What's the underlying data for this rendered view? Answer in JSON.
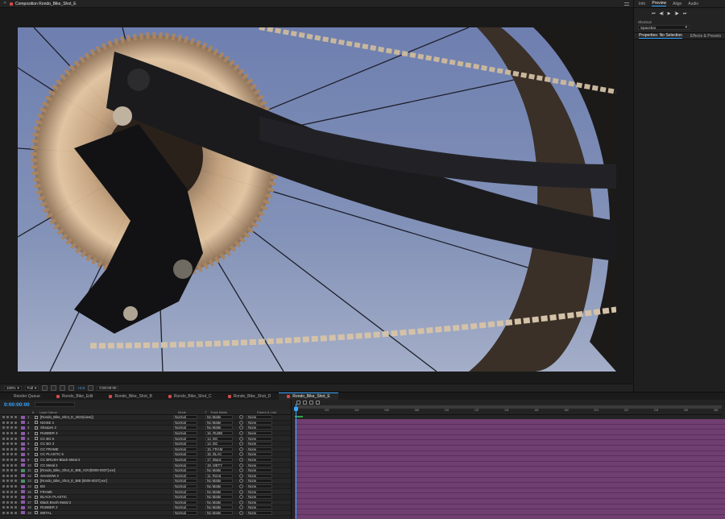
{
  "composition": {
    "tab_title": "Composition  Rondo_Bike_Shot_E"
  },
  "viewer_controls": {
    "zoom": "100%",
    "resolution": "Full",
    "exposure": "+0.0",
    "timecode": "0:00:00:00"
  },
  "right_panel": {
    "tabs": [
      "Info",
      "Preview",
      "Align",
      "Audio"
    ],
    "active_tab": "Preview",
    "transport": [
      "⏮",
      "◀|",
      "▶",
      "|▶",
      "⏭"
    ],
    "shortcut_label": "Shortcut",
    "shortcut_value": "Spacebar",
    "properties_tab": "Properties: No Selection",
    "effects_tab": "Effects & Presets"
  },
  "timeline_tabs": [
    {
      "label": "Render Queue",
      "color": "#1d1d1d"
    },
    {
      "label": "Rondo_Bike_Edit",
      "color": "#d14b4b"
    },
    {
      "label": "Rondo_Bike_Shot_B",
      "color": "#d14b4b"
    },
    {
      "label": "Rondo_Bike_Shot_C",
      "color": "#d14b4b"
    },
    {
      "label": "Rondo_Bike_Shot_D",
      "color": "#d14b4b"
    },
    {
      "label": "Rondo_Bike_Shot_E",
      "color": "#d14b4b"
    }
  ],
  "timeline": {
    "timecode": "0:00:00:00",
    "columns": {
      "num": "#",
      "layer_name": "Layer Name",
      "mode": "Mode",
      "t": "T",
      "track_matte": "Track Matte",
      "parent": "Parent & Link"
    },
    "ruler_ticks": [
      "0f",
      "02f",
      "04f",
      "06f",
      "08f",
      "10f",
      "12f",
      "14f",
      "16f",
      "18f",
      "20f",
      "22f",
      "24f",
      "26f",
      "28f"
    ],
    "layers": [
      {
        "num": "1",
        "name": "[Rondo_Bike_Shot_E_2022(view)]",
        "mode": "Normal",
        "matte": "No Matte",
        "parent": "None",
        "label": "#8a5aa8"
      },
      {
        "num": "2",
        "name": "NOISE 2",
        "mode": "Normal",
        "matte": "No Matte",
        "parent": "None",
        "label": "#8a5aa8"
      },
      {
        "num": "3",
        "name": "Sharpen 2",
        "mode": "Normal",
        "matte": "No Matte",
        "parent": "None",
        "label": "#8a5aa8"
      },
      {
        "num": "4",
        "name": "RUBBER 3",
        "mode": "Normal",
        "matte": "16. RUBB",
        "parent": "None",
        "label": "#8a5aa8"
      },
      {
        "num": "5",
        "name": "CC BG 6",
        "mode": "Normal",
        "matte": "14. BG",
        "parent": "None",
        "label": "#8a5aa8"
      },
      {
        "num": "6",
        "name": "CC BG 3",
        "mode": "Normal",
        "matte": "14. BG",
        "parent": "None",
        "label": "#8a5aa8"
      },
      {
        "num": "7",
        "name": "CC FRAME",
        "mode": "Normal",
        "matte": "15. FRAM",
        "parent": "None",
        "label": "#8a5aa8"
      },
      {
        "num": "8",
        "name": "CC PLASTIC 5",
        "mode": "Normal",
        "matte": "16. BLAC",
        "parent": "None",
        "label": "#8a5aa8"
      },
      {
        "num": "9",
        "name": "CC BRUSH Black Metal 2",
        "mode": "Normal",
        "matte": "17. Black",
        "parent": "None",
        "label": "#8a5aa8"
      },
      {
        "num": "10",
        "name": "CC Metal 2",
        "mode": "Normal",
        "matte": "19. METY",
        "parent": "None",
        "label": "#8a5aa8"
      },
      {
        "num": "11",
        "name": "[Rondo_Bike_Shot_E_BIB_AOV[0000-0037].exr]",
        "mode": "Normal",
        "matte": "No Matte",
        "parent": "None",
        "label": "#4c8d6f"
      },
      {
        "num": "12",
        "name": "SHADOW 2",
        "mode": "Normal",
        "matte": "11. Rond",
        "parent": "None",
        "label": "#8a5aa8"
      },
      {
        "num": "13",
        "name": "[Rondo_Bike_Shot_E_BIB [0000-0037].exr]",
        "mode": "Normal",
        "matte": "No Matte",
        "parent": "None",
        "label": "#4c8d6f"
      },
      {
        "num": "14",
        "name": "BG",
        "mode": "Normal",
        "matte": "No Matte",
        "parent": "None",
        "label": "#8a5aa8"
      },
      {
        "num": "15",
        "name": "FRAME",
        "mode": "Normal",
        "matte": "No Matte",
        "parent": "None",
        "label": "#8a5aa8"
      },
      {
        "num": "16",
        "name": "BLACK PLASTIC",
        "mode": "Normal",
        "matte": "No Matte",
        "parent": "None",
        "label": "#8a5aa8"
      },
      {
        "num": "17",
        "name": "Black Brush Metal 2",
        "mode": "Normal",
        "matte": "No Matte",
        "parent": "None",
        "label": "#8a5aa8"
      },
      {
        "num": "18",
        "name": "RUBBER 2",
        "mode": "Normal",
        "matte": "No Matte",
        "parent": "None",
        "label": "#8a5aa8"
      },
      {
        "num": "19",
        "name": "METAL",
        "mode": "Normal",
        "matte": "No Matte",
        "parent": "None",
        "label": "#8a5aa8"
      }
    ]
  },
  "colors": {
    "accent": "#3aa6ff",
    "track": "#703e70",
    "sky": "#7c8cb5"
  }
}
